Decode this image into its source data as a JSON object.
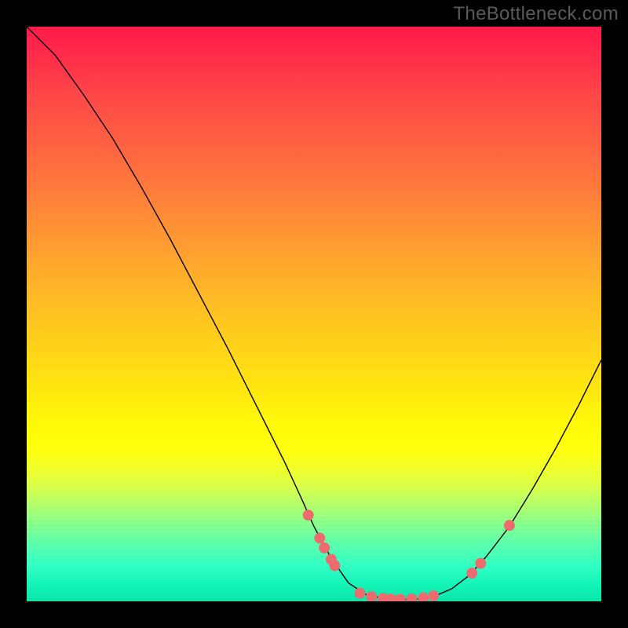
{
  "watermark": "TheBottleneck.com",
  "chart_data": {
    "type": "line",
    "title": "",
    "xlabel": "",
    "ylabel": "",
    "ylim": [
      0,
      100
    ],
    "xlim": [
      0,
      100
    ],
    "curve": [
      {
        "x": 0.0,
        "y": 100.0
      },
      {
        "x": 5.0,
        "y": 95.0
      },
      {
        "x": 10.0,
        "y": 88.0
      },
      {
        "x": 15.0,
        "y": 80.5
      },
      {
        "x": 20.0,
        "y": 72.0
      },
      {
        "x": 25.0,
        "y": 63.0
      },
      {
        "x": 30.0,
        "y": 53.5
      },
      {
        "x": 35.0,
        "y": 44.0
      },
      {
        "x": 40.0,
        "y": 34.0
      },
      {
        "x": 45.0,
        "y": 24.0
      },
      {
        "x": 48.0,
        "y": 17.5
      },
      {
        "x": 50.0,
        "y": 13.0
      },
      {
        "x": 53.0,
        "y": 7.5
      },
      {
        "x": 56.0,
        "y": 3.2
      },
      {
        "x": 59.0,
        "y": 1.2
      },
      {
        "x": 62.0,
        "y": 0.5
      },
      {
        "x": 65.0,
        "y": 0.3
      },
      {
        "x": 68.0,
        "y": 0.4
      },
      {
        "x": 71.0,
        "y": 0.9
      },
      {
        "x": 74.0,
        "y": 2.2
      },
      {
        "x": 77.0,
        "y": 4.5
      },
      {
        "x": 80.0,
        "y": 7.8
      },
      {
        "x": 84.0,
        "y": 13.0
      },
      {
        "x": 88.0,
        "y": 19.5
      },
      {
        "x": 92.0,
        "y": 26.5
      },
      {
        "x": 96.0,
        "y": 34.0
      },
      {
        "x": 100.0,
        "y": 42.0
      }
    ],
    "markers": [
      {
        "x": 49.0,
        "y": 15.0
      },
      {
        "x": 51.0,
        "y": 11.0
      },
      {
        "x": 51.8,
        "y": 9.3
      },
      {
        "x": 53.0,
        "y": 7.3
      },
      {
        "x": 53.6,
        "y": 6.2
      },
      {
        "x": 58.0,
        "y": 1.4
      },
      {
        "x": 60.0,
        "y": 0.8
      },
      {
        "x": 62.0,
        "y": 0.5
      },
      {
        "x": 63.4,
        "y": 0.4
      },
      {
        "x": 65.0,
        "y": 0.35
      },
      {
        "x": 67.0,
        "y": 0.4
      },
      {
        "x": 69.0,
        "y": 0.6
      },
      {
        "x": 70.8,
        "y": 0.95
      },
      {
        "x": 77.5,
        "y": 4.9
      },
      {
        "x": 79.0,
        "y": 6.6
      },
      {
        "x": 84.0,
        "y": 13.2
      }
    ],
    "marker_color": "#ed6a6f",
    "curve_color": "#000000"
  }
}
